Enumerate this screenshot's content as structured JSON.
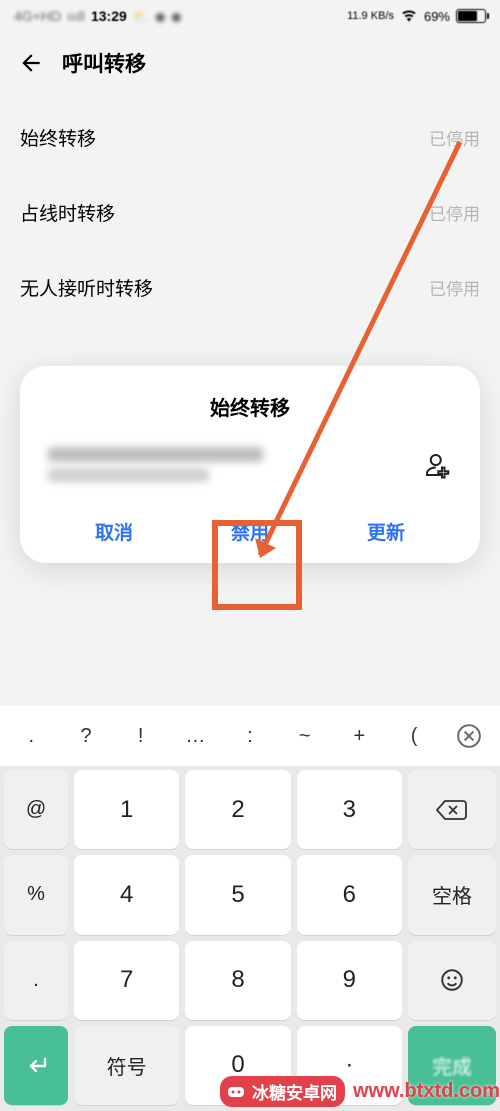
{
  "status": {
    "network": "4G+HD",
    "signal": "ıııll",
    "time": "13:29",
    "netspeed": "11.9 KB/s",
    "battery_pct": "69%"
  },
  "header": {
    "title": "呼叫转移"
  },
  "list": [
    {
      "label": "始终转移",
      "status": "已停用"
    },
    {
      "label": "占线时转移",
      "status": "已停用"
    },
    {
      "label": "无人接听时转移",
      "status": "已停用"
    }
  ],
  "dialog": {
    "title": "始终转移",
    "cancel": "取消",
    "disable": "禁用",
    "update": "更新"
  },
  "keyboard": {
    "symbols": [
      ".",
      "?",
      "!",
      "…",
      ":",
      "~",
      "+",
      "("
    ],
    "side_left": [
      "@",
      "%",
      ".",
      "+"
    ],
    "numbers": [
      [
        "1",
        "2",
        "3"
      ],
      [
        "4",
        "5",
        "6"
      ],
      [
        "7",
        "8",
        "9"
      ]
    ],
    "zero": "0",
    "dot": "·",
    "side_right_top": "",
    "side_right_space": "空格",
    "symbol_key": "符号"
  },
  "watermark": {
    "text": "冰糖安卓网",
    "url": "www.btxtd.com"
  }
}
